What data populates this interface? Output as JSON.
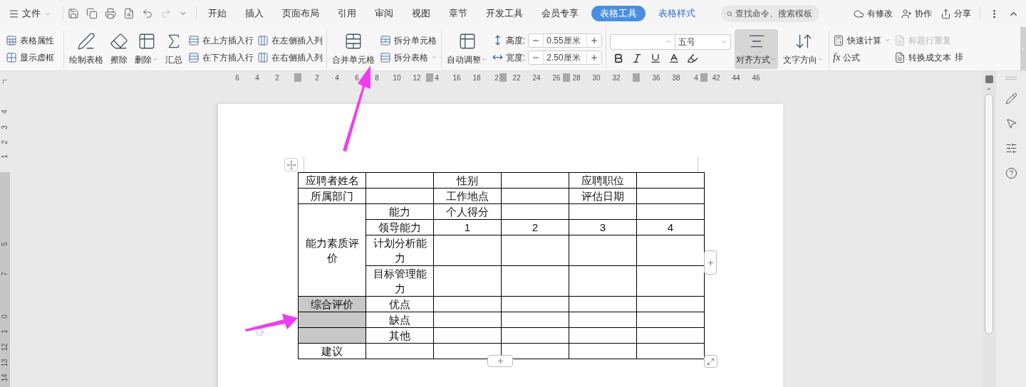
{
  "menu_bar": {
    "file_menu": "文件",
    "tabs": [
      {
        "label": "开始",
        "kind": "normal",
        "selected": false
      },
      {
        "label": "插入",
        "kind": "normal",
        "selected": false
      },
      {
        "label": "页面布局",
        "kind": "normal",
        "selected": false
      },
      {
        "label": "引用",
        "kind": "normal",
        "selected": false
      },
      {
        "label": "审阅",
        "kind": "normal",
        "selected": false
      },
      {
        "label": "视图",
        "kind": "normal",
        "selected": false
      },
      {
        "label": "章节",
        "kind": "normal",
        "selected": false
      },
      {
        "label": "开发工具",
        "kind": "normal",
        "selected": false
      },
      {
        "label": "会员专享",
        "kind": "normal",
        "selected": false
      },
      {
        "label": "表格工具",
        "kind": "contextual",
        "selected": true
      },
      {
        "label": "表格样式",
        "kind": "contextual",
        "selected": false
      }
    ],
    "search": {
      "placeholder": "查找命令、搜索模板"
    },
    "status": "有修改",
    "collaborate": "协作",
    "share": "分享"
  },
  "ribbon": {
    "table_props": "表格属性",
    "show_gridlines": "显示虚框",
    "draw_table": "绘制表格",
    "erase": "擦除",
    "delete": "删除",
    "summary": "汇总",
    "insert_above": "在上方插入行",
    "insert_below": "在下方插入行",
    "insert_left": "在左侧插入列",
    "insert_right": "在右侧插入列",
    "merge_cells": "合并单元格",
    "split_cells": "拆分单元格",
    "split_table": "拆分表格",
    "auto_fit": "自动调整",
    "height": {
      "label": "高度:",
      "value": "0.55厘米"
    },
    "width": {
      "label": "宽度:",
      "value": "2.50厘米"
    },
    "font_size": "五号",
    "align": {
      "label": "对齐方式",
      "selected": true
    },
    "text_direction": "文字方向",
    "quick_calc": "快速计算",
    "formula": {
      "symbol": "fx",
      "label": "公式"
    },
    "repeat_header": {
      "label": "标题行重复",
      "disabled": true
    },
    "to_text": "转换成文本",
    "cut_label": "排"
  },
  "horizontal_ruler": [
    [
      "6",
      "4",
      "2"
    ],
    [
      "2",
      "4",
      "6",
      "8",
      "10",
      "12",
      "4",
      "16",
      "18",
      "2",
      "22",
      "24",
      "26",
      "28",
      "30",
      "32"
    ],
    [
      "36",
      "38",
      "4",
      "42",
      "44",
      "46"
    ]
  ],
  "vertical_ruler": [
    [
      "4",
      "3",
      "2",
      "1"
    ],
    [
      "5",
      "7",
      "0",
      "1",
      "12",
      "13",
      "14"
    ]
  ],
  "table": {
    "rows": [
      [
        {
          "text": "应聘者姓名",
          "selected": false
        },
        {
          "selected": false
        },
        {
          "text": "性别",
          "selected": false
        },
        {
          "selected": false
        },
        {
          "text": "应聘职位",
          "selected": false
        },
        {
          "selected": false
        }
      ],
      [
        {
          "text": "所属部门",
          "selected": false
        },
        {
          "selected": false
        },
        {
          "text": "工作地点",
          "selected": false
        },
        {
          "selected": false
        },
        {
          "text": "评估日期",
          "selected": false
        },
        {
          "selected": false
        }
      ],
      [
        {
          "text": "能力素质评价",
          "rowspan": 4,
          "selected": false
        },
        {
          "text": "能力",
          "selected": false
        },
        {
          "text": "个人得分",
          "selected": false
        },
        {
          "selected": false
        },
        {
          "selected": false
        },
        {
          "selected": false
        }
      ],
      [
        {
          "text": "领导能力",
          "selected": false
        },
        {
          "text": "1",
          "selected": false
        },
        {
          "text": "2",
          "selected": false
        },
        {
          "text": "3",
          "selected": false
        },
        {
          "text": "4",
          "selected": false
        }
      ],
      [
        {
          "text": "计划分析能力",
          "selected": false
        },
        {
          "selected": false
        },
        {
          "selected": false
        },
        {
          "selected": false
        },
        {
          "selected": false
        }
      ],
      [
        {
          "text": "目标管理能力",
          "selected": false
        },
        {
          "selected": false
        },
        {
          "selected": false
        },
        {
          "selected": false
        },
        {
          "selected": false
        }
      ],
      [
        {
          "text": "综合评价",
          "selected": true
        },
        {
          "text": "优点",
          "selected": false
        },
        {
          "selected": false
        },
        {
          "selected": false
        },
        {
          "selected": false
        },
        {
          "selected": false
        }
      ],
      [
        {
          "selected": true
        },
        {
          "text": "缺点",
          "selected": false
        },
        {
          "selected": false
        },
        {
          "selected": false
        },
        {
          "selected": false
        },
        {
          "selected": false
        }
      ],
      [
        {
          "selected": true
        },
        {
          "text": "其他",
          "selected": false
        },
        {
          "selected": false
        },
        {
          "selected": false
        },
        {
          "selected": false
        },
        {
          "selected": false
        }
      ],
      [
        {
          "text": "建议",
          "selected": false
        },
        {
          "selected": false
        },
        {
          "selected": false
        },
        {
          "selected": false
        },
        {
          "selected": false
        },
        {
          "selected": false
        }
      ]
    ]
  }
}
